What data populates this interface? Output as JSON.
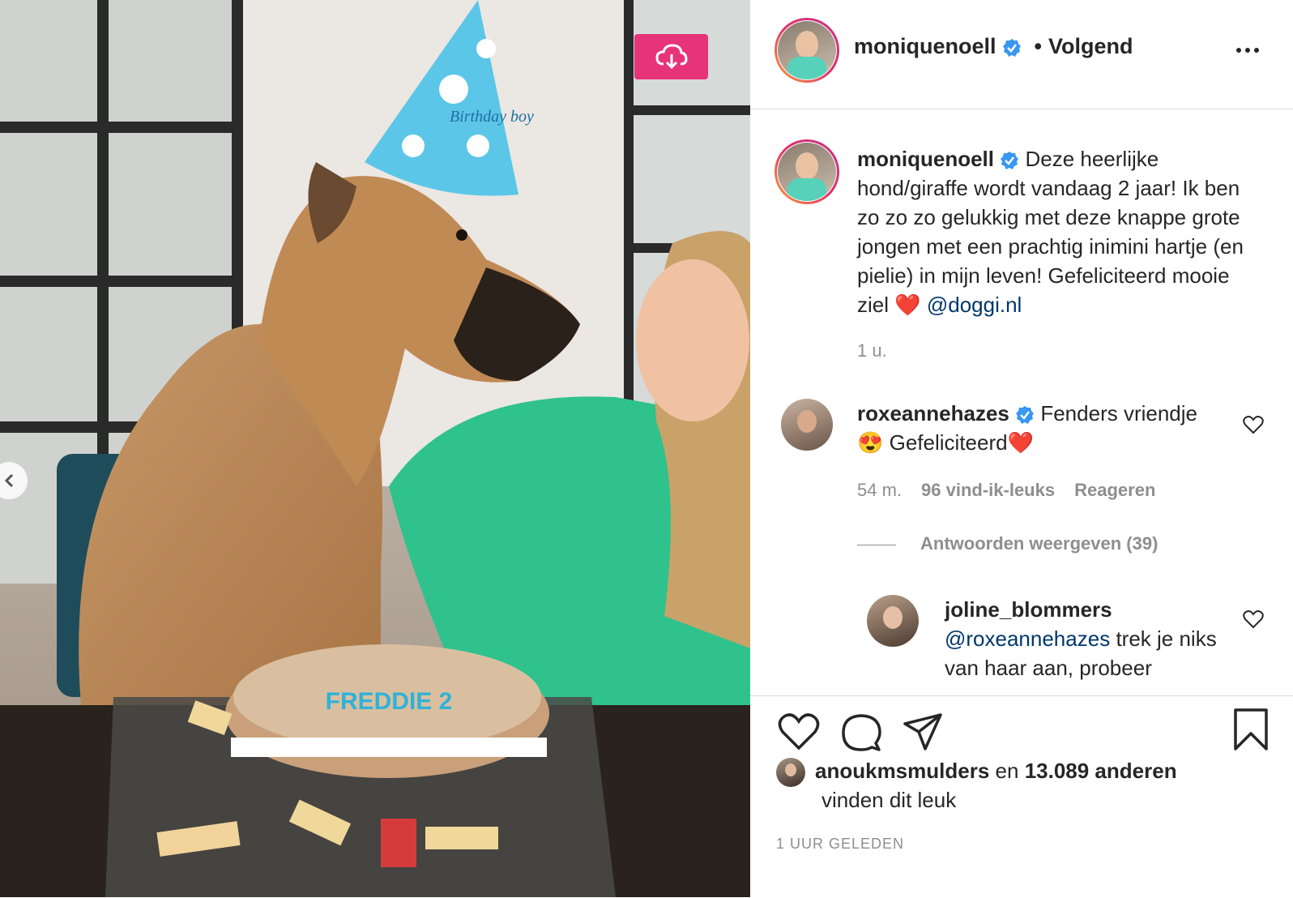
{
  "post": {
    "author": "moniquenoell",
    "follow_status": "Volgend",
    "dot": "•",
    "caption_text": "Deze heerlijke hond/giraffe wordt vandaag 2 jaar! Ik ben zo zo zo gelukkig met deze knappe grote jongen met een prachtig inimini hartje (en pielie) in mijn leven! Gefeliciteerd mooie ziel ❤️",
    "caption_mention": "@doggi.nl",
    "caption_time": "1 u."
  },
  "comments": [
    {
      "user": "roxeannehazes",
      "text_1": "Fenders vriendje",
      "emoji_1": "😍",
      "text_2": "Gefeliciteerd",
      "emoji_2": "❤️",
      "time": "54 m.",
      "likes": "96 vind-ik-leuks",
      "reply": "Reageren",
      "view_replies": "Antwoorden weergeven (39)"
    },
    {
      "user": "joline_blommers",
      "mention": "@roxeannehazes",
      "text": "trek je niks van haar aan, probeer"
    }
  ],
  "likes": {
    "user": "anoukmsmulders",
    "connector": "en",
    "count": "13.089 anderen",
    "suffix": "vinden dit leuk"
  },
  "posted_ago": "1 UUR GELEDEN",
  "photo_cake_text": "FREDDIE 2",
  "photo_hat_text": "Birthday boy",
  "icons": [
    "download-icon",
    "chevron-left-icon",
    "more-icon",
    "verified-icon",
    "heart-icon",
    "comment-icon",
    "share-icon",
    "bookmark-icon"
  ],
  "colors": {
    "accent": "#e6337a",
    "verified": "#3897f0",
    "mention": "#00376b",
    "muted": "#8e8e8e"
  }
}
